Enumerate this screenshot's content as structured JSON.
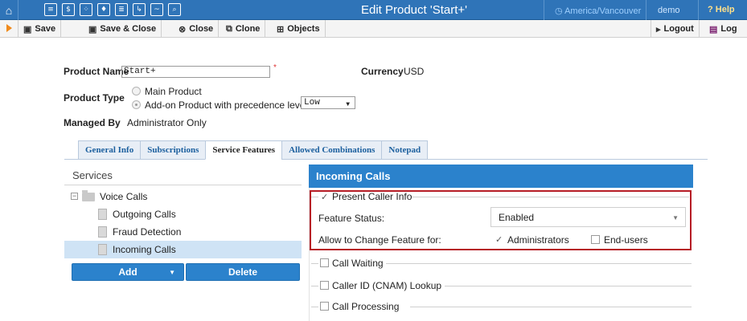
{
  "topbar": {
    "home_icon": "home-icon",
    "nav_icons": [
      "menu-icon",
      "dollar-icon",
      "grid-icon",
      "person-icon",
      "sliders-icon",
      "export-icon",
      "chart-icon",
      "search-icon"
    ],
    "title": "Edit Product 'Start+'",
    "timezone": "America/Vancouver",
    "user": "demo",
    "help": "Help"
  },
  "toolbar": {
    "save": "Save",
    "save_close": "Save & Close",
    "close": "Close",
    "clone": "Clone",
    "objects": "Objects",
    "logout": "Logout",
    "log": "Log"
  },
  "form": {
    "product_name_label": "Product Name",
    "product_name_value": "Start+",
    "required_mark": "*",
    "currency_label": "Currency",
    "currency_value": "USD",
    "product_type_label": "Product Type",
    "type_main": "Main Product",
    "type_addon": "Add-on Product with precedence level",
    "precedence_value": "Low",
    "managed_by_label": "Managed By",
    "managed_by_value": "Administrator Only"
  },
  "tabs": [
    "General Info",
    "Subscriptions",
    "Service Features",
    "Allowed Combinations",
    "Notepad"
  ],
  "services": {
    "title": "Services",
    "root": "Voice Calls",
    "items": [
      "Outgoing Calls",
      "Fraud Detection",
      "Incoming Calls"
    ],
    "add_label": "Add",
    "delete_label": "Delete"
  },
  "panel": {
    "title": "Incoming Calls",
    "present_caller_info": "Present Caller Info",
    "feature_status_label": "Feature Status:",
    "feature_status_value": "Enabled",
    "allow_change_label": "Allow to Change Feature for:",
    "administrators": "Administrators",
    "end_users": "End-users",
    "call_waiting": "Call Waiting",
    "caller_id_lookup": "Caller ID (CNAM) Lookup",
    "call_processing": "Call Processing"
  },
  "colors": {
    "accent_blue": "#2b82cc",
    "highlight_red": "#b61c25",
    "selected_row": "#cfe3f5"
  }
}
